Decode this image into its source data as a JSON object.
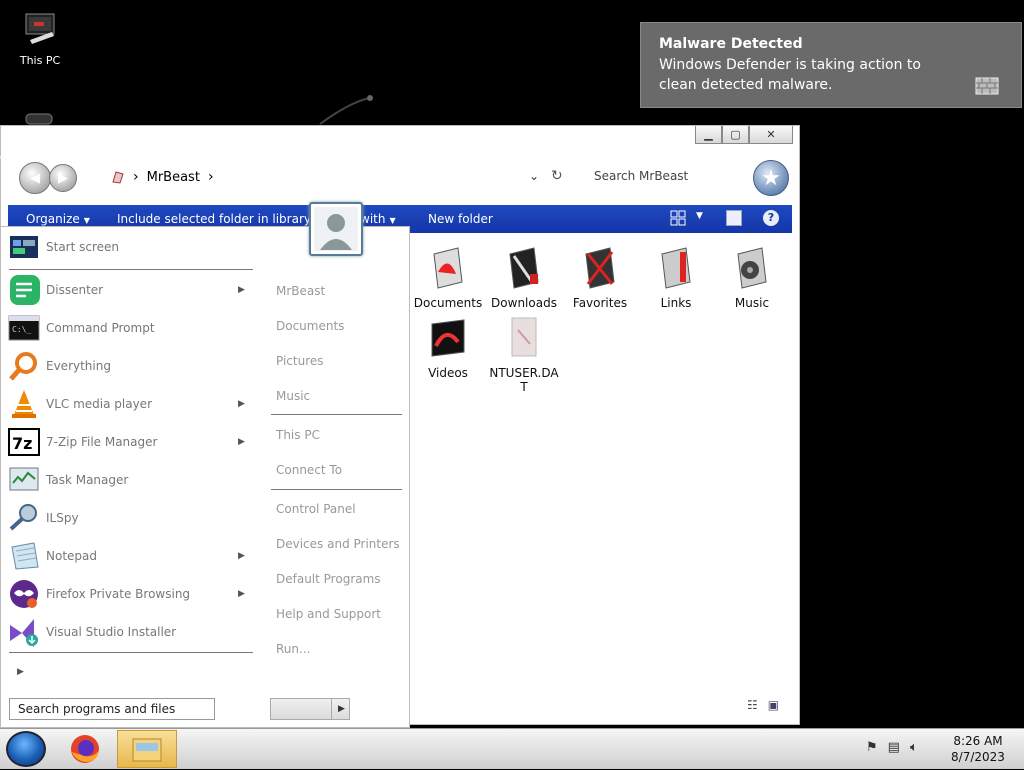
{
  "desktop": {
    "icon_label": "This PC"
  },
  "toast": {
    "title": "Malware Detected",
    "message": "Windows Defender is taking action to clean detected malware."
  },
  "explorer": {
    "breadcrumb": [
      "MrBeast"
    ],
    "search_placeholder": "Search MrBeast",
    "toolbar": {
      "organize": "Organize",
      "include": "Include selected folder in library",
      "share": "with",
      "new_folder": "New folder"
    },
    "files": [
      {
        "name": "Documents",
        "icon": "documents-folder-icon"
      },
      {
        "name": "Downloads",
        "icon": "downloads-folder-icon"
      },
      {
        "name": "Favorites",
        "icon": "favorites-folder-icon"
      },
      {
        "name": "Links",
        "icon": "links-folder-icon"
      },
      {
        "name": "Music",
        "icon": "music-folder-icon"
      },
      {
        "name": "Videos",
        "icon": "videos-folder-icon"
      },
      {
        "name": "NTUSER.DAT",
        "icon": "dat-file-icon"
      }
    ]
  },
  "start_menu": {
    "programs": [
      {
        "label": "Start screen",
        "icon": "start-screen-icon",
        "submenu": false
      },
      {
        "label": "Dissenter",
        "icon": "dissenter-icon",
        "submenu": true
      },
      {
        "label": "Command Prompt",
        "icon": "cmd-icon",
        "submenu": false
      },
      {
        "label": "Everything",
        "icon": "everything-search-icon",
        "submenu": false
      },
      {
        "label": "VLC media player",
        "icon": "vlc-icon",
        "submenu": true
      },
      {
        "label": "7-Zip File Manager",
        "icon": "7zip-icon",
        "submenu": true
      },
      {
        "label": "Task Manager",
        "icon": "task-manager-icon",
        "submenu": false
      },
      {
        "label": "ILSpy",
        "icon": "ilspy-icon",
        "submenu": false
      },
      {
        "label": "Notepad",
        "icon": "notepad-icon",
        "submenu": true
      },
      {
        "label": "Firefox Private Browsing",
        "icon": "firefox-private-icon",
        "submenu": true
      },
      {
        "label": "Visual Studio Installer",
        "icon": "visual-studio-installer-icon",
        "submenu": false
      }
    ],
    "right_links": [
      "MrBeast",
      "Documents",
      "Pictures",
      "Music",
      "This PC",
      "Connect To",
      "Control Panel",
      "Devices and Printers",
      "Default Programs",
      "Help and Support",
      "Run..."
    ],
    "search_placeholder": "Search programs and files"
  },
  "taskbar": {
    "time": "8:26 AM",
    "date": "8/7/2023"
  },
  "colors": {
    "toolbar_blue": "#1a3fb4",
    "toast_gray": "#6a6a6a"
  }
}
